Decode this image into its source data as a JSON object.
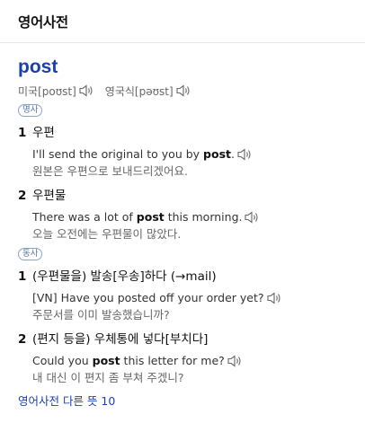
{
  "header": {
    "title": "영어사전"
  },
  "entry": {
    "word": "post",
    "pron_us": "미국[poʊst]",
    "pron_uk": "영국식[pəʊst]",
    "pos1": "명사",
    "pos2": "동사",
    "senses": [
      {
        "num": "1",
        "label": "우편",
        "ex_pre": "I'll send the original to you by ",
        "ex_bold": "post",
        "ex_post": ".",
        "ko": "원본은 우편으로 보내드리겠어요."
      },
      {
        "num": "2",
        "label": "우편물",
        "ex_pre": "There was a lot of ",
        "ex_bold": "post",
        "ex_post": " this morning.",
        "ko": "오늘 오전에는 우편물이 많았다."
      },
      {
        "num": "1",
        "label": "(우편물을) 발송[우송]하다 (→mail)",
        "ex_pre": "[VN] Have you posted off your order yet?",
        "ex_bold": "",
        "ex_post": "",
        "ko": "주문서를 이미 발송했습니까?"
      },
      {
        "num": "2",
        "label": "(편지 등을) 우체통에 넣다[부치다]",
        "ex_pre": "Could you ",
        "ex_bold": "post",
        "ex_post": " this letter for me?",
        "ko": "내 대신 이 편지 좀 부쳐 주겠니?"
      }
    ],
    "more_link": "영어사전 다른 뜻 10"
  },
  "icons": {
    "speaker": "speaker-icon"
  }
}
